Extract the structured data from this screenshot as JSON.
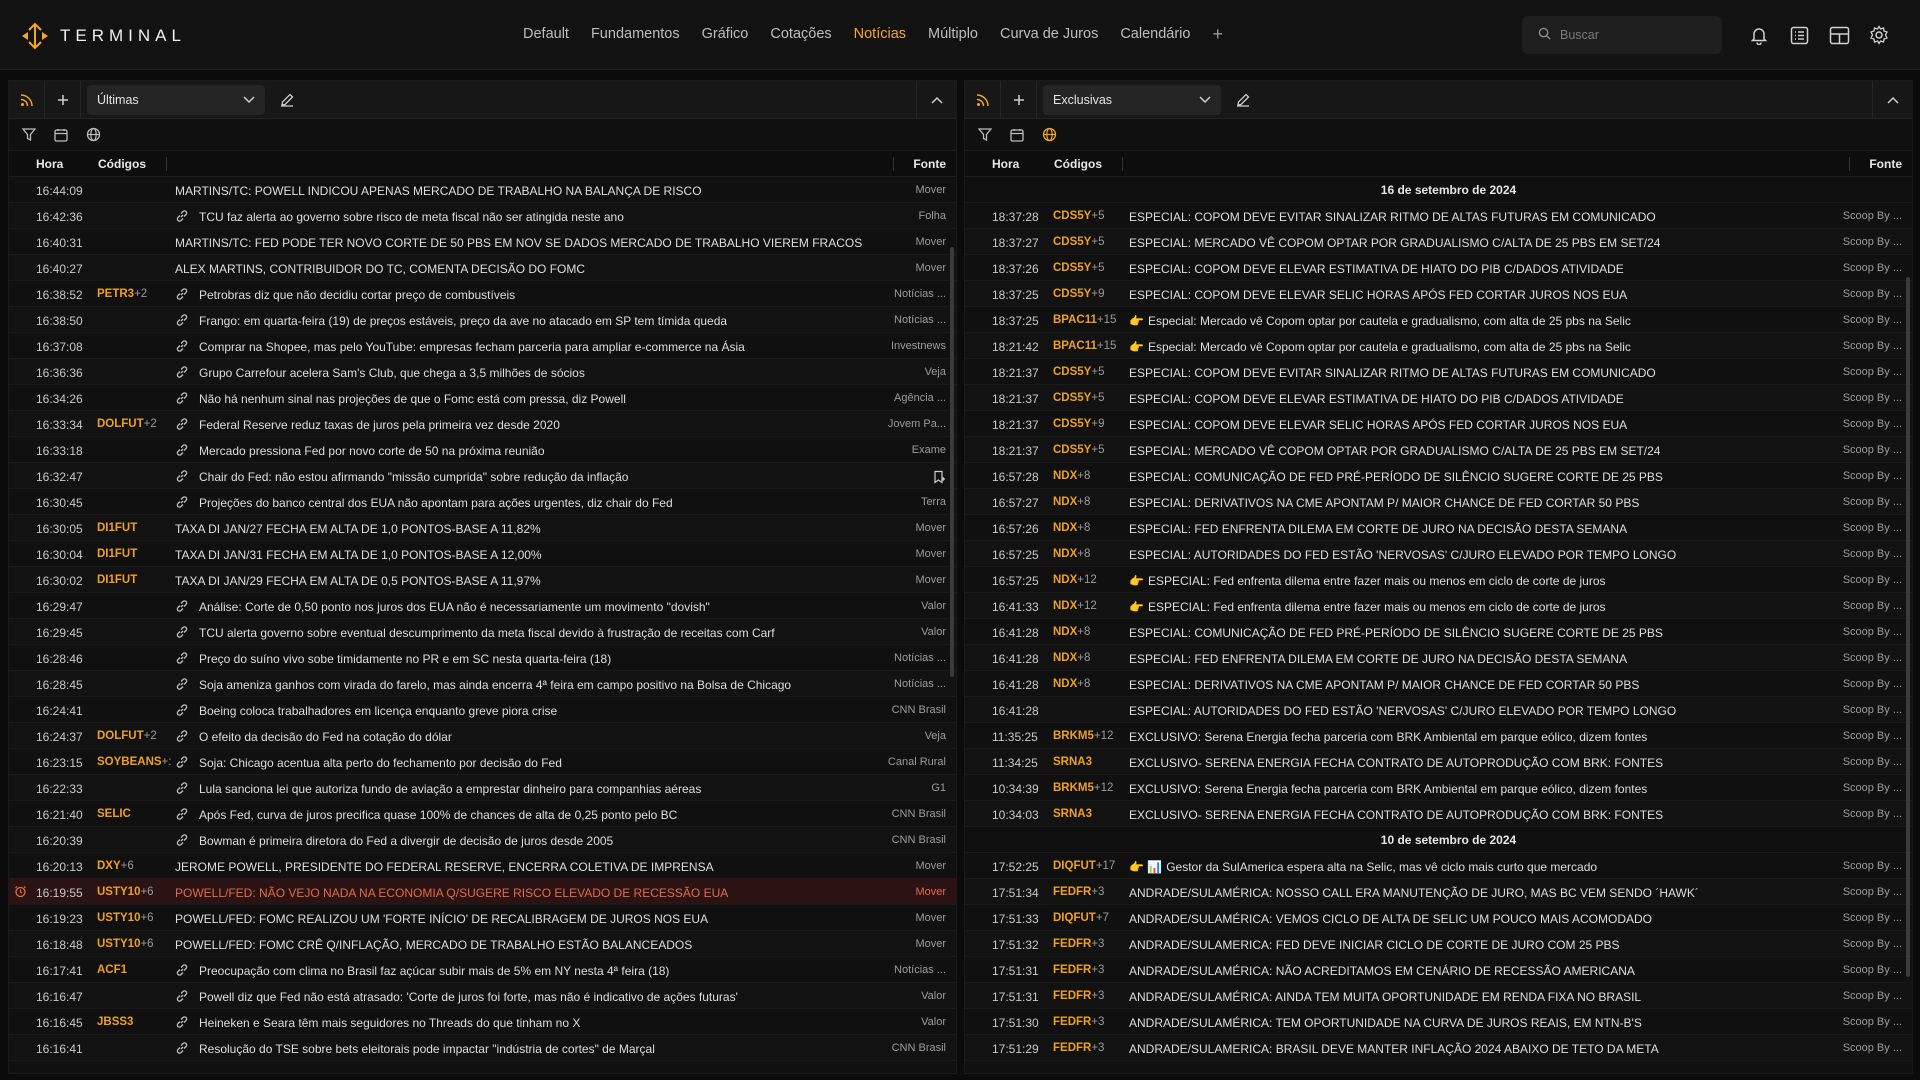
{
  "app": {
    "name": "TERMINAL"
  },
  "nav": {
    "items": [
      "Default",
      "Fundamentos",
      "Gráfico",
      "Cotações",
      "Notícias",
      "Múltiplo",
      "Curva de Juros",
      "Calendário"
    ],
    "active": "Notícias",
    "add_label": "+"
  },
  "search": {
    "placeholder": "Buscar"
  },
  "colors": {
    "accent": "#f5a623",
    "code": "#f0a020",
    "alert": "#e36a4a",
    "background": "#0b0b0b"
  },
  "icons": {
    "top": [
      "bell-icon",
      "news-list-icon",
      "layout-icon",
      "gear-icon"
    ]
  },
  "left_panel": {
    "select_label": "Últimas",
    "columns": {
      "hora": "Hora",
      "codigos": "Códigos",
      "fonte": "Fonte"
    },
    "rows": [
      {
        "time": "16:44:09",
        "code": "",
        "extra": "",
        "link": false,
        "headline": "MARTINS/TC: POWELL INDICOU APENAS MERCADO DE TRABALHO NA BALANÇA DE RISCO",
        "source": "Mover"
      },
      {
        "time": "16:42:36",
        "code": "",
        "extra": "",
        "link": true,
        "headline": "TCU faz alerta ao governo sobre risco de meta fiscal não ser atingida neste ano",
        "source": "Folha"
      },
      {
        "time": "16:40:31",
        "code": "",
        "extra": "",
        "link": false,
        "headline": "MARTINS/TC: FED PODE TER NOVO CORTE DE 50 PBS EM NOV SE DADOS MERCADO DE TRABALHO VIEREM FRACOS",
        "source": "Mover"
      },
      {
        "time": "16:40:27",
        "code": "",
        "extra": "",
        "link": false,
        "headline": "ALEX MARTINS, CONTRIBUIDOR DO TC, COMENTA DECISÃO DO FOMC",
        "source": "Mover"
      },
      {
        "time": "16:38:52",
        "code": "PETR3",
        "extra": "+2",
        "link": true,
        "headline": "Petrobras diz que não decidiu cortar preço de combustíveis",
        "source": "Notícias ..."
      },
      {
        "time": "16:38:50",
        "code": "",
        "extra": "",
        "link": true,
        "headline": "Frango: em quarta-feira (19) de preços estáveis, preço da ave no atacado em SP tem tímida queda",
        "source": "Notícias ..."
      },
      {
        "time": "16:37:08",
        "code": "",
        "extra": "",
        "link": true,
        "headline": "Comprar na Shopee, mas pelo YouTube: empresas fecham parceria para ampliar e-commerce na Ásia",
        "source": "Investnews"
      },
      {
        "time": "16:36:36",
        "code": "",
        "extra": "",
        "link": true,
        "headline": "Grupo Carrefour acelera Sam's Club, que chega a 3,5 milhões de sócios",
        "source": "Veja"
      },
      {
        "time": "16:34:26",
        "code": "",
        "extra": "",
        "link": true,
        "headline": "Não há nenhum sinal nas projeções de que o Fomc está com pressa, diz Powell",
        "source": "Agência ..."
      },
      {
        "time": "16:33:34",
        "code": "DOLFUT",
        "extra": "+2",
        "link": true,
        "headline": "Federal Reserve reduz taxas de juros pela primeira vez desde 2020",
        "source": "Jovem Pa..."
      },
      {
        "time": "16:33:18",
        "code": "",
        "extra": "",
        "link": true,
        "headline": "Mercado pressiona Fed por novo corte de 50 na próxima reunião",
        "source": "Exame"
      },
      {
        "time": "16:32:47",
        "code": "",
        "extra": "",
        "link": true,
        "headline": "Chair do Fed: não estou afirmando \"missão cumprida\" sobre redução da inflação",
        "source": ""
      },
      {
        "time": "16:30:45",
        "code": "",
        "extra": "",
        "link": true,
        "headline": "Projeções do banco central dos EUA não apontam para ações urgentes, diz chair do Fed",
        "source": "Terra"
      },
      {
        "time": "16:30:05",
        "code": "DI1FUT",
        "extra": "",
        "link": false,
        "headline": "TAXA DI JAN/27 FECHA EM ALTA DE 1,0 PONTOS-BASE A 11,82%",
        "source": "Mover"
      },
      {
        "time": "16:30:04",
        "code": "DI1FUT",
        "extra": "",
        "link": false,
        "headline": "TAXA DI JAN/31 FECHA EM ALTA DE 1,0 PONTOS-BASE A 12,00%",
        "source": "Mover"
      },
      {
        "time": "16:30:02",
        "code": "DI1FUT",
        "extra": "",
        "link": false,
        "headline": "TAXA DI JAN/29 FECHA EM ALTA DE 0,5 PONTOS-BASE A 11,97%",
        "source": "Mover"
      },
      {
        "time": "16:29:47",
        "code": "",
        "extra": "",
        "link": true,
        "headline": "Análise: Corte de 0,50 ponto nos juros dos EUA não é necessariamente um movimento \"dovish\"",
        "source": "Valor"
      },
      {
        "time": "16:29:45",
        "code": "",
        "extra": "",
        "link": true,
        "headline": "TCU alerta governo sobre eventual descumprimento da meta fiscal devido à frustração de receitas com Carf",
        "source": "Valor"
      },
      {
        "time": "16:28:46",
        "code": "",
        "extra": "",
        "link": true,
        "headline": "Preço do suíno vivo sobe timidamente no PR e em SC nesta quarta-feira (18)",
        "source": "Notícias ..."
      },
      {
        "time": "16:28:45",
        "code": "",
        "extra": "",
        "link": true,
        "headline": "Soja ameniza ganhos com virada do farelo, mas ainda encerra 4ª feira em campo positivo na Bolsa de Chicago",
        "source": "Notícias ..."
      },
      {
        "time": "16:24:41",
        "code": "",
        "extra": "",
        "link": true,
        "headline": "Boeing coloca trabalhadores em licença enquanto greve piora crise",
        "source": "CNN Brasil"
      },
      {
        "time": "16:24:37",
        "code": "DOLFUT",
        "extra": "+2",
        "link": true,
        "headline": "O efeito da decisão do Fed na cotação do dólar",
        "source": "Veja"
      },
      {
        "time": "16:23:15",
        "code": "SOYBEANS",
        "extra": "+:",
        "link": true,
        "headline": "Soja: Chicago acentua alta perto do fechamento por decisão do Fed",
        "source": "Canal Rural"
      },
      {
        "time": "16:22:33",
        "code": "",
        "extra": "",
        "link": true,
        "headline": "Lula sanciona lei que autoriza fundo de aviação a emprestar dinheiro para companhias aéreas",
        "source": "G1"
      },
      {
        "time": "16:21:40",
        "code": "SELIC",
        "extra": "",
        "link": true,
        "headline": "Após Fed, curva de juros precifica quase 100% de chances de alta de 0,25 ponto pelo BC",
        "source": "CNN Brasil"
      },
      {
        "time": "16:20:39",
        "code": "",
        "extra": "",
        "link": true,
        "headline": "Bowman é primeira diretora do Fed a divergir de decisão de juros desde 2005",
        "source": "CNN Brasil"
      },
      {
        "time": "16:20:13",
        "code": "DXY",
        "extra": "+6",
        "link": false,
        "headline": "JEROME POWELL, PRESIDENTE DO FEDERAL RESERVE, ENCERRA COLETIVA DE IMPRENSA",
        "source": "Mover"
      },
      {
        "time": "16:19:55",
        "code": "USTY10",
        "extra": "+6",
        "link": false,
        "alert": true,
        "headline": "POWELL/FED: NÃO VEJO NADA NA ECONOMIA Q/SUGERE RISCO ELEVADO DE RECESSÃO EUA",
        "source": "Mover"
      },
      {
        "time": "16:19:23",
        "code": "USTY10",
        "extra": "+6",
        "link": false,
        "headline": "POWELL/FED: FOMC REALIZOU UM 'FORTE INÍCIO' DE RECALIBRAGEM DE JUROS NOS EUA",
        "source": "Mover"
      },
      {
        "time": "16:18:48",
        "code": "USTY10",
        "extra": "+6",
        "link": false,
        "headline": "POWELL/FED: FOMC CRÊ Q/INFLAÇÃO, MERCADO DE TRABALHO ESTÃO BALANCEADOS",
        "source": "Mover"
      },
      {
        "time": "16:17:41",
        "code": "ACF1",
        "extra": "",
        "link": true,
        "headline": "Preocupação com clima no Brasil faz açúcar subir mais de 5% em NY nesta 4ª feira (18)",
        "source": "Notícias ..."
      },
      {
        "time": "16:16:47",
        "code": "",
        "extra": "",
        "link": true,
        "headline": "Powell diz que Fed não está atrasado: 'Corte de juros foi forte, mas não é indicativo de ações futuras'",
        "source": "Valor"
      },
      {
        "time": "16:16:45",
        "code": "JBSS3",
        "extra": "",
        "link": true,
        "headline": "Heineken e Seara têm mais seguidores no Threads do que tinham no X",
        "source": "Valor"
      },
      {
        "time": "16:16:41",
        "code": "",
        "extra": "",
        "link": true,
        "headline": "Resolução do TSE sobre bets eleitorais pode impactar \"indústria de cortes\" de Marçal",
        "source": "CNN Brasil"
      }
    ]
  },
  "right_panel": {
    "select_label": "Exclusivas",
    "columns": {
      "hora": "Hora",
      "codigos": "Códigos",
      "fonte": "Fonte"
    },
    "groups": [
      {
        "date": "16 de setembro de 2024",
        "rows": [
          {
            "time": "18:37:28",
            "code": "CDS5Y",
            "extra": "+5",
            "emoji": "",
            "headline": "ESPECIAL: COPOM DEVE EVITAR SINALIZAR RITMO DE ALTAS FUTURAS EM COMUNICADO",
            "source": "Scoop By ..."
          },
          {
            "time": "18:37:27",
            "code": "CDS5Y",
            "extra": "+5",
            "emoji": "",
            "headline": "ESPECIAL: MERCADO VÊ COPOM OPTAR POR GRADUALISMO C/ALTA DE 25 PBS EM SET/24",
            "source": "Scoop By ..."
          },
          {
            "time": "18:37:26",
            "code": "CDS5Y",
            "extra": "+5",
            "emoji": "",
            "headline": "ESPECIAL: COPOM DEVE ELEVAR ESTIMATIVA DE HIATO DO PIB C/DADOS ATIVIDADE",
            "source": "Scoop By ..."
          },
          {
            "time": "18:37:25",
            "code": "CDS5Y",
            "extra": "+9",
            "emoji": "",
            "headline": "ESPECIAL: COPOM DEVE ELEVAR SELIC HORAS APÓS FED CORTAR JUROS NOS EUA",
            "source": "Scoop By ..."
          },
          {
            "time": "18:37:25",
            "code": "BPAC11",
            "extra": "+15",
            "emoji": "👉",
            "headline": "Especial: Mercado vê Copom optar por cautela e gradualismo, com alta de 25 pbs na Selic",
            "source": "Scoop By ..."
          },
          {
            "time": "18:21:42",
            "code": "BPAC11",
            "extra": "+15",
            "emoji": "👉",
            "headline": "Especial: Mercado vê Copom optar por cautela e gradualismo, com alta de 25 pbs na Selic",
            "source": "Scoop By ..."
          },
          {
            "time": "18:21:37",
            "code": "CDS5Y",
            "extra": "+5",
            "emoji": "",
            "headline": "ESPECIAL: COPOM DEVE EVITAR SINALIZAR RITMO DE ALTAS FUTURAS EM COMUNICADO",
            "source": "Scoop By ..."
          },
          {
            "time": "18:21:37",
            "code": "CDS5Y",
            "extra": "+5",
            "emoji": "",
            "headline": "ESPECIAL: COPOM DEVE ELEVAR ESTIMATIVA DE HIATO DO PIB C/DADOS ATIVIDADE",
            "source": "Scoop By ..."
          },
          {
            "time": "18:21:37",
            "code": "CDS5Y",
            "extra": "+9",
            "emoji": "",
            "headline": "ESPECIAL: COPOM DEVE ELEVAR SELIC HORAS APÓS FED CORTAR JUROS NOS EUA",
            "source": "Scoop By ..."
          },
          {
            "time": "18:21:37",
            "code": "CDS5Y",
            "extra": "+5",
            "emoji": "",
            "headline": "ESPECIAL: MERCADO VÊ COPOM OPTAR POR GRADUALISMO C/ALTA DE 25 PBS EM SET/24",
            "source": "Scoop By ..."
          },
          {
            "time": "16:57:28",
            "code": "NDX",
            "extra": "+8",
            "emoji": "",
            "headline": "ESPECIAL: COMUNICAÇÃO DE FED PRÉ-PERÍODO DE SILÊNCIO SUGERE CORTE DE 25 PBS",
            "source": "Scoop By ..."
          },
          {
            "time": "16:57:27",
            "code": "NDX",
            "extra": "+8",
            "emoji": "",
            "headline": "ESPECIAL: DERIVATIVOS NA CME APONTAM P/ MAIOR CHANCE DE FED CORTAR 50 PBS",
            "source": "Scoop By ..."
          },
          {
            "time": "16:57:26",
            "code": "NDX",
            "extra": "+8",
            "emoji": "",
            "headline": "ESPECIAL: FED ENFRENTA DILEMA EM CORTE DE JURO NA DECISÃO DESTA SEMANA",
            "source": "Scoop By ..."
          },
          {
            "time": "16:57:25",
            "code": "NDX",
            "extra": "+8",
            "emoji": "",
            "headline": "ESPECIAL: AUTORIDADES DO FED ESTÃO 'NERVOSAS' C/JURO ELEVADO POR TEMPO LONGO",
            "source": "Scoop By ..."
          },
          {
            "time": "16:57:25",
            "code": "NDX",
            "extra": "+12",
            "emoji": "👉",
            "headline": "ESPECIAL: Fed enfrenta dilema entre fazer mais ou menos em ciclo de corte de juros",
            "source": "Scoop By ..."
          },
          {
            "time": "16:41:33",
            "code": "NDX",
            "extra": "+12",
            "emoji": "👉",
            "headline": "ESPECIAL: Fed enfrenta dilema entre fazer mais ou menos em ciclo de corte de juros",
            "source": "Scoop By ..."
          },
          {
            "time": "16:41:28",
            "code": "NDX",
            "extra": "+8",
            "emoji": "",
            "headline": "ESPECIAL: COMUNICAÇÃO DE FED PRÉ-PERÍODO DE SILÊNCIO SUGERE CORTE DE 25 PBS",
            "source": "Scoop By ..."
          },
          {
            "time": "16:41:28",
            "code": "NDX",
            "extra": "+8",
            "emoji": "",
            "headline": "ESPECIAL: FED ENFRENTA DILEMA EM CORTE DE JURO NA DECISÃO DESTA SEMANA",
            "source": "Scoop By ..."
          },
          {
            "time": "16:41:28",
            "code": "NDX",
            "extra": "+8",
            "emoji": "",
            "headline": "ESPECIAL: DERIVATIVOS NA CME APONTAM P/ MAIOR CHANCE DE FED CORTAR 50 PBS",
            "source": "Scoop By ..."
          },
          {
            "time": "16:41:28",
            "code": "",
            "extra": "",
            "emoji": "",
            "headline": "ESPECIAL: AUTORIDADES DO FED ESTÃO 'NERVOSAS' C/JURO ELEVADO POR TEMPO LONGO",
            "source": "Scoop By ..."
          },
          {
            "time": "11:35:25",
            "code": "BRKM5",
            "extra": "+12",
            "emoji": "",
            "headline": "EXCLUSIVO: Serena Energia fecha parceria com BRK Ambiental em parque eólico, dizem fontes",
            "source": "Scoop By ..."
          },
          {
            "time": "11:34:25",
            "code": "SRNA3",
            "extra": "",
            "emoji": "",
            "headline": "EXCLUSIVO- SERENA ENERGIA FECHA CONTRATO DE AUTOPRODUÇÃO COM BRK: FONTES",
            "source": "Scoop By ..."
          },
          {
            "time": "10:34:39",
            "code": "BRKM5",
            "extra": "+12",
            "emoji": "",
            "headline": "EXCLUSIVO: Serena Energia fecha parceria com BRK Ambiental em parque eólico, dizem fontes",
            "source": "Scoop By ..."
          },
          {
            "time": "10:34:03",
            "code": "SRNA3",
            "extra": "",
            "emoji": "",
            "headline": "EXCLUSIVO- SERENA ENERGIA FECHA CONTRATO DE AUTOPRODUÇÃO COM BRK: FONTES",
            "source": "Scoop By ..."
          }
        ]
      },
      {
        "date": "10 de setembro de 2024",
        "rows": [
          {
            "time": "17:52:25",
            "code": "DIQFUT",
            "extra": "+17",
            "emoji": "👉 📊",
            "headline": "Gestor da SulAmerica espera alta na Selic, mas vê ciclo mais curto que mercado",
            "source": "Scoop By ..."
          },
          {
            "time": "17:51:34",
            "code": "FEDFR",
            "extra": "+3",
            "emoji": "",
            "headline": "ANDRADE/SULAMÉRICA: NOSSO CALL ERA MANUTENÇÃO DE JURO, MAS BC VEM SENDO ´HAWK´",
            "source": "Scoop By ..."
          },
          {
            "time": "17:51:33",
            "code": "DIQFUT",
            "extra": "+7",
            "emoji": "",
            "headline": "ANDRADE/SULAMÉRICA: VEMOS CICLO DE ALTA DE SELIC UM POUCO MAIS ACOMODADO",
            "source": "Scoop By ..."
          },
          {
            "time": "17:51:32",
            "code": "FEDFR",
            "extra": "+3",
            "emoji": "",
            "headline": "ANDRADE/SULAMERICA: FED DEVE INICIAR CICLO DE CORTE DE JURO COM 25 PBS",
            "source": "Scoop By ..."
          },
          {
            "time": "17:51:31",
            "code": "FEDFR",
            "extra": "+3",
            "emoji": "",
            "headline": "ANDRADE/SULAMÉRICA: NÃO ACREDITAMOS EM CENÁRIO DE RECESSÃO AMERICANA",
            "source": "Scoop By ..."
          },
          {
            "time": "17:51:31",
            "code": "FEDFR",
            "extra": "+3",
            "emoji": "",
            "headline": "ANDRADE/SULAMÉRICA: AINDA TEM MUITA OPORTUNIDADE EM RENDA FIXA NO BRASIL",
            "source": "Scoop By ..."
          },
          {
            "time": "17:51:30",
            "code": "FEDFR",
            "extra": "+3",
            "emoji": "",
            "headline": "ANDRADE/SULAMÉRICA: TEM OPORTUNIDADE NA CURVA DE JUROS REAIS, EM NTN-B'S",
            "source": "Scoop By ..."
          },
          {
            "time": "17:51:29",
            "code": "FEDFR",
            "extra": "+3",
            "emoji": "",
            "headline": "ANDRADE/SULAMERICA: BRASIL DEVE MANTER INFLAÇÃO 2024 ABAIXO DE TETO DA META",
            "source": "Scoop By ..."
          }
        ]
      }
    ]
  }
}
